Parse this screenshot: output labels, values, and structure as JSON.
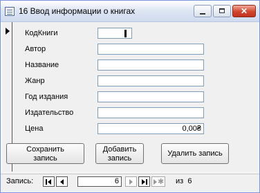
{
  "window": {
    "title": "16 Ввод информации о книгах"
  },
  "form": {
    "fields": [
      {
        "label": "КодКниги",
        "value": ""
      },
      {
        "label": "Автор",
        "value": ""
      },
      {
        "label": "Название",
        "value": ""
      },
      {
        "label": "Жанр",
        "value": ""
      },
      {
        "label": "Год издания",
        "value": ""
      },
      {
        "label": "Издательство",
        "value": ""
      },
      {
        "label": "Цена",
        "value": "0,00₴"
      }
    ],
    "buttons": {
      "save_line1": "Сохранить",
      "save_line2": "запись",
      "add_line1": "Добавить",
      "add_line2": "запись",
      "delete": "Удалить запись"
    }
  },
  "navigation": {
    "label": "Запись:",
    "current": "6",
    "of_label": "из",
    "total": "6"
  },
  "icons": [
    "app-form-icon",
    "minimize-icon",
    "maximize-icon",
    "close-icon",
    "record-selector-arrow-icon",
    "first-record-icon",
    "prev-record-icon",
    "next-record-icon",
    "last-record-icon",
    "new-record-icon"
  ]
}
